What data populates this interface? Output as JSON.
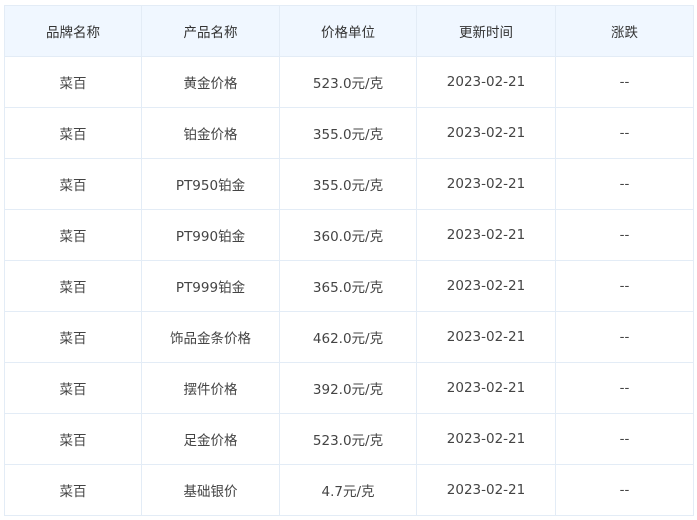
{
  "table": {
    "headers": [
      "品牌名称",
      "产品名称",
      "价格单位",
      "更新时间",
      "涨跌"
    ],
    "rows": [
      [
        "菜百",
        "黄金价格",
        "523.0元/克",
        "2023-02-21",
        "--"
      ],
      [
        "菜百",
        "铂金价格",
        "355.0元/克",
        "2023-02-21",
        "--"
      ],
      [
        "菜百",
        "PT950铂金",
        "355.0元/克",
        "2023-02-21",
        "--"
      ],
      [
        "菜百",
        "PT990铂金",
        "360.0元/克",
        "2023-02-21",
        "--"
      ],
      [
        "菜百",
        "PT999铂金",
        "365.0元/克",
        "2023-02-21",
        "--"
      ],
      [
        "菜百",
        "饰品金条价格",
        "462.0元/克",
        "2023-02-21",
        "--"
      ],
      [
        "菜百",
        "摆件价格",
        "392.0元/克",
        "2023-02-21",
        "--"
      ],
      [
        "菜百",
        "足金价格",
        "523.0元/克",
        "2023-02-21",
        "--"
      ],
      [
        "菜百",
        "基础银价",
        "4.7元/克",
        "2023-02-21",
        "--"
      ]
    ]
  },
  "colors": {
    "header_bg": "#f0f7ff",
    "border": "#e3ecf6",
    "text": "#444444"
  }
}
